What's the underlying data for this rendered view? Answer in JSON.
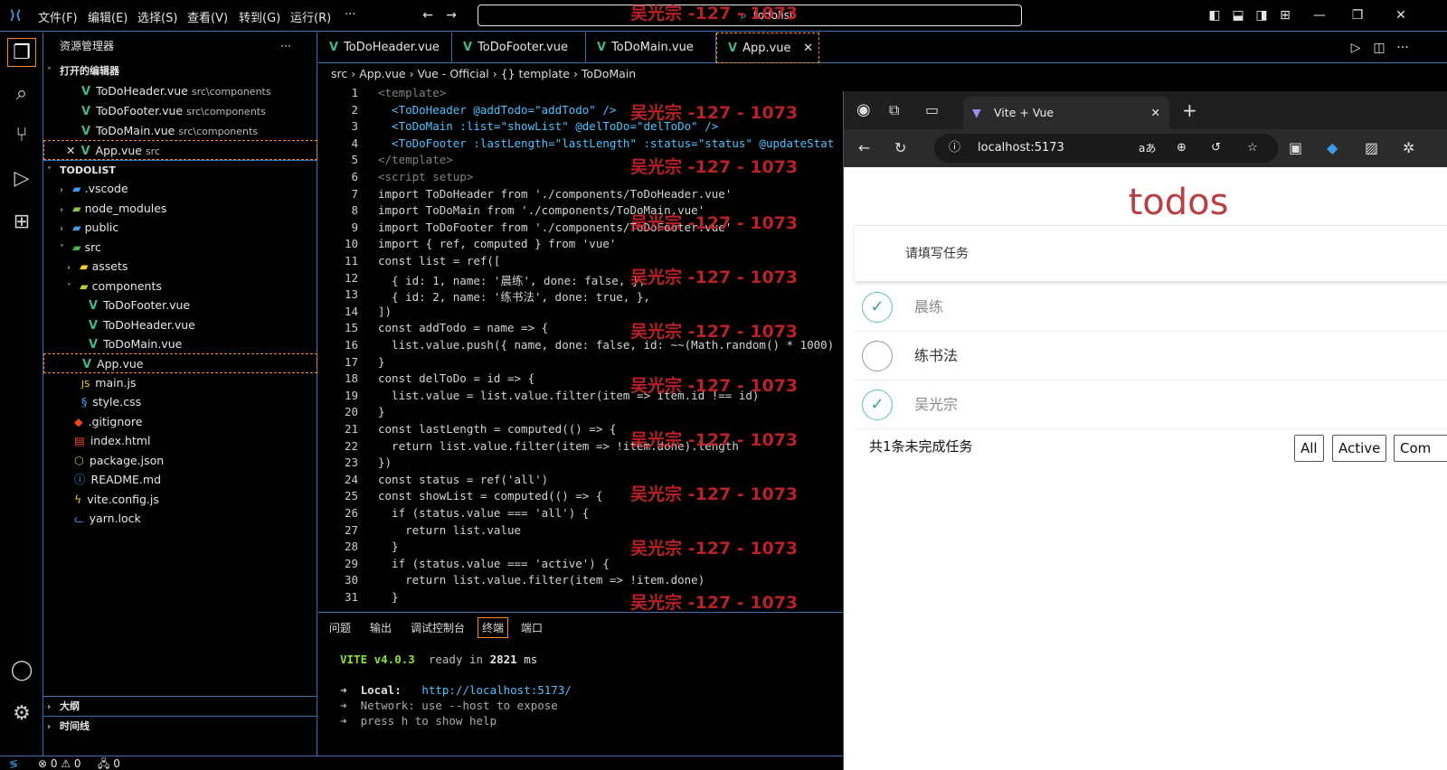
{
  "titlebar": {
    "menus": [
      "文件(F)",
      "编辑(E)",
      "选择(S)",
      "查看(V)",
      "转到(G)",
      "运行(R)",
      "···"
    ],
    "search": "todolist"
  },
  "sidebar": {
    "title": "资源管理器",
    "open_editors_label": "打开的编辑器",
    "open_editors": [
      {
        "name": "ToDoHeader.vue",
        "path": "src\\components"
      },
      {
        "name": "ToDoFooter.vue",
        "path": "src\\components"
      },
      {
        "name": "ToDoMain.vue",
        "path": "src\\components"
      },
      {
        "name": "App.vue",
        "path": "src"
      }
    ],
    "project_label": "TODOLIST",
    "tree": [
      ".vscode",
      "node_modules",
      "public",
      "src",
      "assets",
      "components",
      "ToDoFooter.vue",
      "ToDoHeader.vue",
      "ToDoMain.vue",
      "App.vue",
      "main.js",
      "style.css",
      ".gitignore",
      "index.html",
      "package.json",
      "README.md",
      "vite.config.js",
      "yarn.lock"
    ],
    "outline_label": "大纲",
    "timeline_label": "时间线"
  },
  "tabs": [
    "ToDoHeader.vue",
    "ToDoFooter.vue",
    "ToDoMain.vue",
    "App.vue"
  ],
  "breadcrumb": "src  ›  App.vue  ›  Vue - Official  ›  {} template  ›  ToDoMain",
  "editor": {
    "line_numbers": [
      "1",
      "2",
      "3",
      "4",
      "5",
      "6",
      "7",
      "8",
      "9",
      "10",
      "11",
      "12",
      "13",
      "14",
      "15",
      "16",
      "17",
      "18",
      "19",
      "20",
      "21",
      "22",
      "23",
      "24",
      "25",
      "26",
      "27",
      "28",
      "29",
      "30",
      "31"
    ],
    "lines": [
      "<template>",
      "  <ToDoHeader @addTodo=\"addTodo\" />",
      "  <ToDoMain :list=\"showList\" @delToDo=\"delToDo\" />",
      "  <ToDoFooter :lastLength=\"lastLength\" :status=\"status\" @updateStat",
      "</template>",
      "<script setup>",
      "import ToDoHeader from './components/ToDoHeader.vue'",
      "import ToDoMain from './components/ToDoMain.vue'",
      "import ToDoFooter from './components/ToDoFooter.vue'",
      "import { ref, computed } from 'vue'",
      "const list = ref([",
      "  { id: 1, name: '晨练', done: false, },",
      "  { id: 2, name: '练书法', done: true, },",
      "])",
      "const addTodo = name => {",
      "  list.value.push({ name, done: false, id: ~~(Math.random() * 1000)",
      "}",
      "const delToDo = id => {",
      "  list.value = list.value.filter(item => item.id !== id)",
      "}",
      "const lastLength = computed(() => {",
      "  return list.value.filter(item => !item.done).length",
      "})",
      "const status = ref('all')",
      "const showList = computed(() => {",
      "  if (status.value === 'all') {",
      "    return list.value",
      "  }",
      "  if (status.value === 'active') {",
      "    return list.value.filter(item => !item.done)",
      "  }"
    ],
    "watermark": "吴光宗 -127 - 1073"
  },
  "panel": {
    "tabs": [
      "问题",
      "输出",
      "调试控制台",
      "终端",
      "端口"
    ],
    "term_vite": "VITE v4.0.3",
    "term_ready": "ready in",
    "term_ms": "2821",
    "term_ms_unit": "ms",
    "term_local_label": "➜  Local:",
    "term_local_url": "http://localhost:5173/",
    "term_network": "➜  Network: use --host to expose",
    "term_help": "➜  press h to show help"
  },
  "statusbar": {
    "problems": "⊗ 0 ⚠ 0",
    "ports": "🖧 0"
  },
  "browser": {
    "tab_title": "Vite + Vue",
    "url": "localhost:5173",
    "app_title": "todos",
    "placeholder": "请填写任务",
    "todos": [
      {
        "name": "晨练",
        "done": true
      },
      {
        "name": "练书法",
        "done": false
      },
      {
        "name": "吴光宗",
        "done": true
      }
    ],
    "footer_text": "共1条未完成任务",
    "filters": [
      "All",
      "Active",
      "Com"
    ]
  }
}
